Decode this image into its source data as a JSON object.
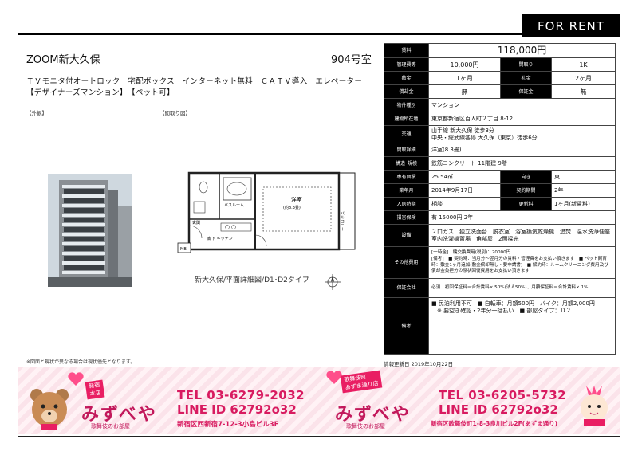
{
  "header": {
    "for_rent": "FOR RENT"
  },
  "property": {
    "name": "ZOOM新大久保",
    "room": "904号室",
    "features_line1": "ＴＶモニタ付オートロック　宅配ボックス　インターネット無料　ＣＡＴＶ導入　エレベーター",
    "features_line2": "【デザイナーズマンション】　【ペット可】",
    "exterior_label": "【外観】",
    "floorplan_label": "【間取り図】",
    "floorplan_caption": "新大久保/平面詳細図/D1･D2タイプ",
    "left_note": "※図面と現状が異なる場合は現状優先となります。"
  },
  "floorplan_labels": {
    "western_room": "洋室",
    "western_size": "(約8.3畳)",
    "kitchen": "廊下\nキッチン",
    "bath": "バスルーム",
    "balcony": "バルコニー",
    "entrance": "玄関",
    "mb": "MB"
  },
  "spec": {
    "rent_label": "賃料",
    "rent": "118,000円",
    "mgmt_label": "管理費等",
    "mgmt": "10,000円",
    "layout_label": "間取り",
    "layout": "1K",
    "deposit_label": "敷金",
    "deposit": "1ヶ月",
    "keymoney_label": "礼金",
    "keymoney": "2ヶ月",
    "amort_label": "償却金",
    "amort": "無",
    "guarantee_label": "保証金",
    "guarantee": "無",
    "type_label": "物件種別",
    "type": "マンション",
    "address_label": "建物所在地",
    "address": "東京都新宿区百人町２丁目 8-12",
    "transport_label": "交通",
    "transport1": "山手線 新大久保 徒歩3分",
    "transport2": "中央・総武線各停 大久保（東京）徒歩6分",
    "rooms_label": "間取詳細",
    "rooms": "洋室(8.3畳)",
    "structure_label": "構造･規模",
    "structure": "鉄筋コンクリート 11階建 9階",
    "area_label": "専有面積",
    "area": "25.54㎡",
    "facing_label": "向き",
    "facing": "東",
    "built_label": "築年月",
    "built": "2014年9月17日",
    "period_label": "契約期間",
    "period": "2年",
    "movein_label": "入居時期",
    "movein": "相談",
    "renew_label": "更新料",
    "renew": "1ヶ月(新賃料)",
    "insurance_label": "損害保険",
    "insurance": "有 15000円 2年",
    "equip_label": "設備",
    "equip": "２口ガス　独立洗面台　脱衣室　浴室換気乾燥機　追焚　温水洗浄便座　室内洗濯機置場　角部屋　2面採光",
    "other_label": "その他費用",
    "other1": "[一時金]　鍵交換費用(税別)：20000円",
    "other2": "[備考]　■ 契約時：当月分～翌月分の賃料・管理費をお支払い頂きます　■ ペット飼育時：敷金1ヶ月追加(敷金償却無し・要申請書)　■ 解約時：ルームクリーニング費用及び償却金負担分の原状回復費用をお支払い頂きます",
    "gcompany_label": "保証会社",
    "gcompany": "必須　初回保証料＝合計賃料× 50%(法人50%)、月額保証料＝合計賃料× 1%",
    "remarks_label": "備考",
    "remarks1": "■ 民泊利用不可　■ 自転車：月額500円　バイク：月額2,000円",
    "remarks2": "　※ 要空き確認・2年分一括払い　■ 部屋タイプ：Ｄ２",
    "updated": "情報更新日 2019年10月22日"
  },
  "ad": {
    "left": {
      "tag": "新宿\n本店",
      "logo": "みずべや",
      "sub": "歌舞伎のお部屋",
      "tel": "TEL 03-6279-2032",
      "line": "LINE ID 62792o32",
      "addr": "新宿区西新宿7-12-3小島ビル3F"
    },
    "right": {
      "tag": "歌舞伎町\nあずま通り店",
      "logo": "みずべや",
      "sub": "歌舞伎のお部屋",
      "tel": "TEL 03-6205-5732",
      "line": "LINE ID 62792o32",
      "addr": "新宿区歌舞伎町1-8-3良川ビル2F(あずま通り)"
    }
  },
  "colors": {
    "ad_pink": "#d81b60",
    "header_black": "#000000"
  }
}
